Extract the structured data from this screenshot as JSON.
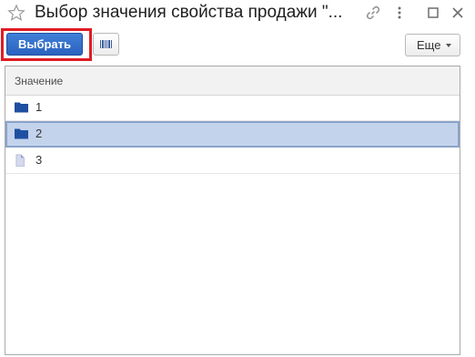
{
  "window": {
    "title": "Выбор значения свойства продажи \"..."
  },
  "toolbar": {
    "select_label": "Выбрать",
    "more_label": "Еще"
  },
  "table": {
    "column_header": "Значение",
    "rows": [
      {
        "value": "1",
        "icon": "folder-icon",
        "selected": false
      },
      {
        "value": "2",
        "icon": "folder-icon",
        "selected": true
      },
      {
        "value": "3",
        "icon": "document-icon",
        "selected": false
      }
    ]
  },
  "colors": {
    "accent_button": "#2b63bf",
    "selected_row": "#c4d3ec",
    "highlight_frame": "#e01b24",
    "folder_icon": "#1f4fa0"
  }
}
